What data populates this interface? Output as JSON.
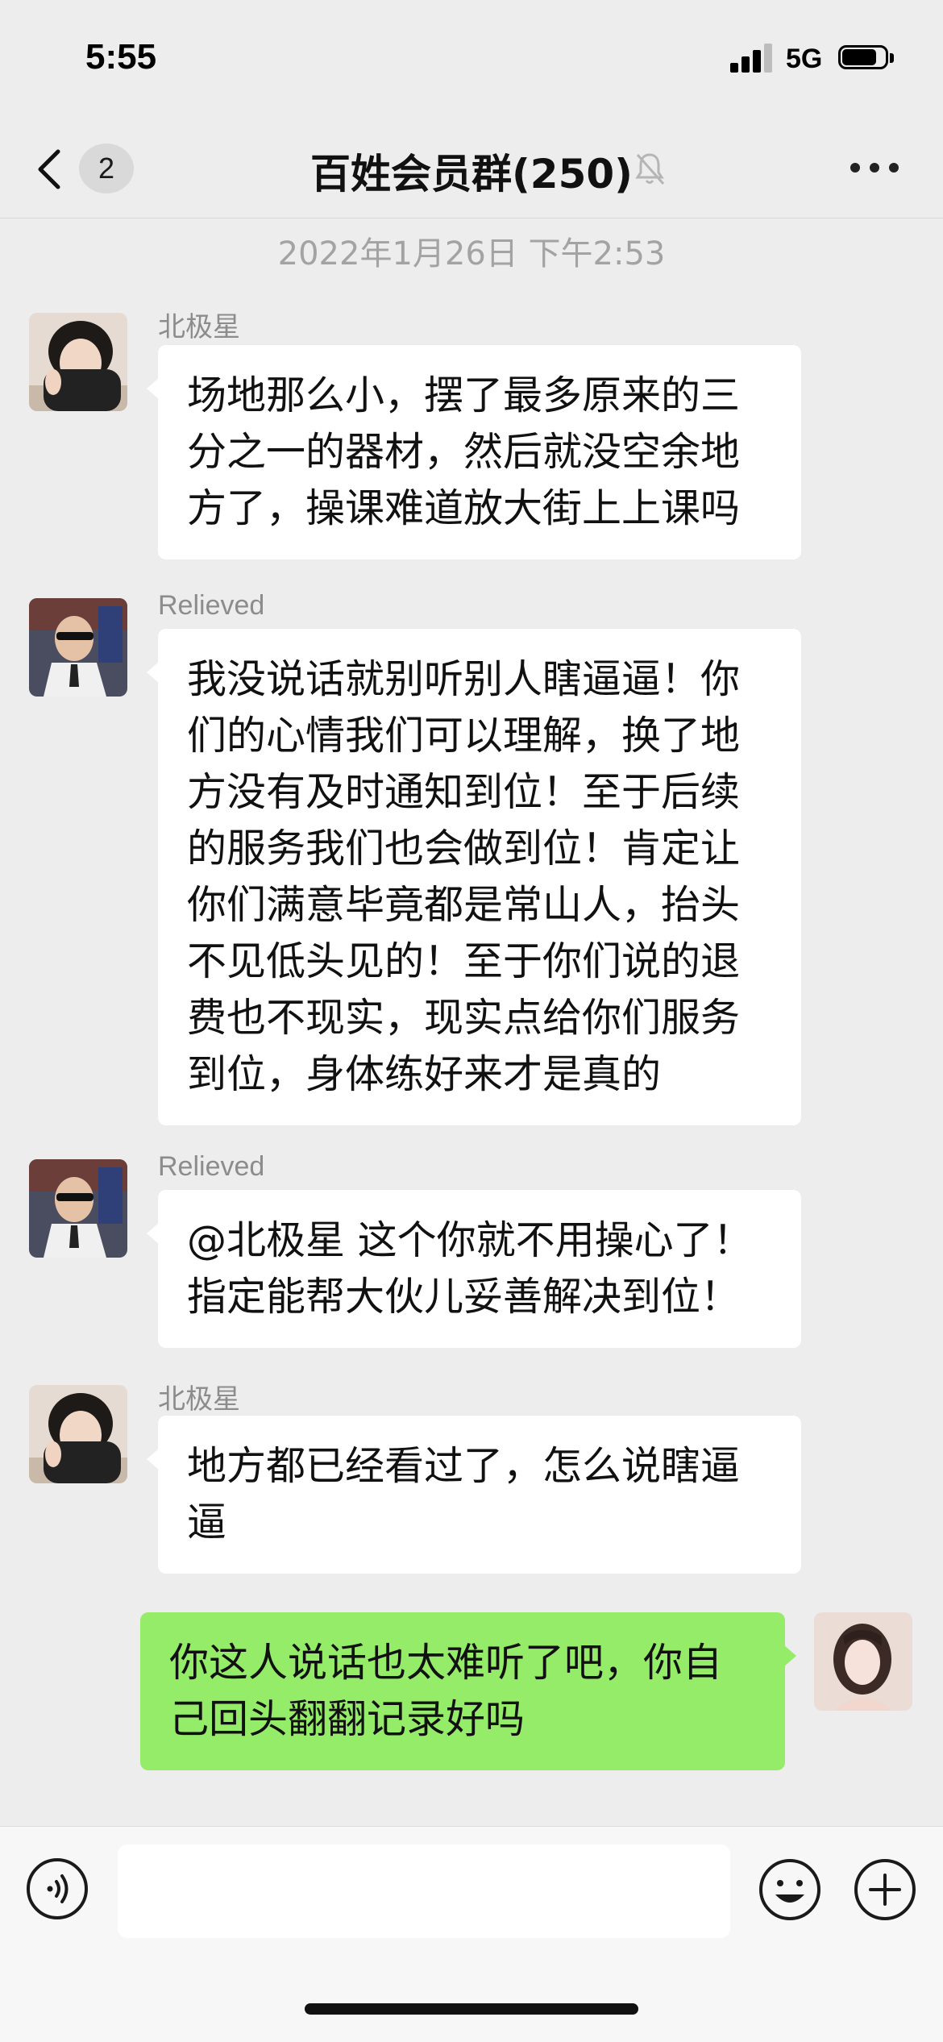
{
  "status_bar": {
    "time": "5:55",
    "network": "5G",
    "signal_bars_active": 3,
    "signal_bars_total": 4,
    "battery_level": 0.8
  },
  "nav": {
    "back_icon": "chevron-left",
    "unread_count": "2",
    "title": "百姓会员群(250)",
    "mute_icon": "bell-slash",
    "more_icon": "ellipsis"
  },
  "timestamp": "2022年1月26日 下午2:53",
  "messages": [
    {
      "sender": "北极星",
      "text": "场地那么小，摆了最多原来的三分之一的器材，然后就没空余地方了，操课难道放大街上上课吗"
    },
    {
      "sender": "Relieved",
      "text": "我没说话就别听别人瞎逼逼！你们的心情我们可以理解，换了地方没有及时通知到位！至于后续的服务我们也会做到位！肯定让你们满意毕竟都是常山人，抬头不见低头见的！至于你们说的退费也不现实，现实点给你们服务到位，身体练好来才是真的"
    },
    {
      "sender": "Relieved",
      "text": "@北极星 这个你就不用操心了！指定能帮大伙儿妥善解决到位！"
    },
    {
      "sender": "北极星",
      "text": "地方都已经看过了，怎么说瞎逼逼"
    },
    {
      "sender": "",
      "text": "你这人说话也太难听了吧，你自己回头翻翻记录好吗"
    }
  ],
  "input_bar": {
    "voice_icon": "voice-wave",
    "text_value": "",
    "emoji_icon": "smiley-face",
    "plus_icon": "plus-circle"
  },
  "colors": {
    "background": "#ededed",
    "self_bubble": "#95ec69",
    "other_bubble": "#ffffff",
    "timestamp_text": "#a3a3a3"
  }
}
